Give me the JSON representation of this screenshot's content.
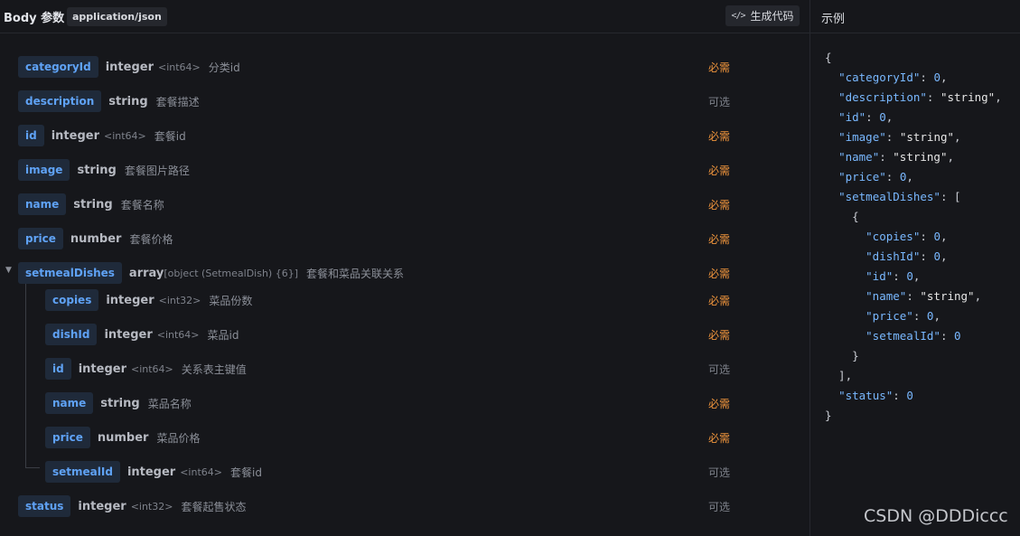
{
  "header": {
    "title": "Body 参数",
    "content_type": "application/json",
    "gen_code_icon": "</>",
    "gen_code_label": "生成代码"
  },
  "params": [
    {
      "name": "categoryId",
      "type": "integer",
      "format": "<int64>",
      "desc": "分类id",
      "req": "必需"
    },
    {
      "name": "description",
      "type": "string",
      "format": "",
      "desc": "套餐描述",
      "req": "可选"
    },
    {
      "name": "id",
      "type": "integer",
      "format": "<int64>",
      "desc": "套餐id",
      "req": "必需"
    },
    {
      "name": "image",
      "type": "string",
      "format": "",
      "desc": "套餐图片路径",
      "req": "必需"
    },
    {
      "name": "name",
      "type": "string",
      "format": "",
      "desc": "套餐名称",
      "req": "必需"
    },
    {
      "name": "price",
      "type": "number",
      "format": "",
      "desc": "套餐价格",
      "req": "必需"
    },
    {
      "name": "setmealDishes",
      "type": "array",
      "format": "[object (SetmealDish) {6}]",
      "desc": "套餐和菜品关联关系",
      "req": "必需",
      "toggle": "▼"
    },
    {
      "name": "copies",
      "type": "integer",
      "format": "<int32>",
      "desc": "菜品份数",
      "req": "必需"
    },
    {
      "name": "dishId",
      "type": "integer",
      "format": "<int64>",
      "desc": "菜品id",
      "req": "必需"
    },
    {
      "name": "id",
      "type": "integer",
      "format": "<int64>",
      "desc": "关系表主键值",
      "req": "可选"
    },
    {
      "name": "name",
      "type": "string",
      "format": "",
      "desc": "菜品名称",
      "req": "必需"
    },
    {
      "name": "price",
      "type": "number",
      "format": "",
      "desc": "菜品价格",
      "req": "必需"
    },
    {
      "name": "setmealId",
      "type": "integer",
      "format": "<int64>",
      "desc": "套餐id",
      "req": "可选"
    },
    {
      "name": "status",
      "type": "integer",
      "format": "<int32>",
      "desc": "套餐起售状态",
      "req": "可选"
    }
  ],
  "example": {
    "title": "示例",
    "lines": [
      [
        {
          "t": "p",
          "v": "{"
        }
      ],
      [
        {
          "t": "p",
          "v": "  "
        },
        {
          "t": "k",
          "v": "\"categoryId\""
        },
        {
          "t": "p",
          "v": ": "
        },
        {
          "t": "n",
          "v": "0"
        },
        {
          "t": "p",
          "v": ","
        }
      ],
      [
        {
          "t": "p",
          "v": "  "
        },
        {
          "t": "k",
          "v": "\"description\""
        },
        {
          "t": "p",
          "v": ": "
        },
        {
          "t": "s",
          "v": "\"string\""
        },
        {
          "t": "p",
          "v": ","
        }
      ],
      [
        {
          "t": "p",
          "v": "  "
        },
        {
          "t": "k",
          "v": "\"id\""
        },
        {
          "t": "p",
          "v": ": "
        },
        {
          "t": "n",
          "v": "0"
        },
        {
          "t": "p",
          "v": ","
        }
      ],
      [
        {
          "t": "p",
          "v": "  "
        },
        {
          "t": "k",
          "v": "\"image\""
        },
        {
          "t": "p",
          "v": ": "
        },
        {
          "t": "s",
          "v": "\"string\""
        },
        {
          "t": "p",
          "v": ","
        }
      ],
      [
        {
          "t": "p",
          "v": "  "
        },
        {
          "t": "k",
          "v": "\"name\""
        },
        {
          "t": "p",
          "v": ": "
        },
        {
          "t": "s",
          "v": "\"string\""
        },
        {
          "t": "p",
          "v": ","
        }
      ],
      [
        {
          "t": "p",
          "v": "  "
        },
        {
          "t": "k",
          "v": "\"price\""
        },
        {
          "t": "p",
          "v": ": "
        },
        {
          "t": "n",
          "v": "0"
        },
        {
          "t": "p",
          "v": ","
        }
      ],
      [
        {
          "t": "p",
          "v": "  "
        },
        {
          "t": "k",
          "v": "\"setmealDishes\""
        },
        {
          "t": "p",
          "v": ": ["
        }
      ],
      [
        {
          "t": "p",
          "v": "    {"
        }
      ],
      [
        {
          "t": "p",
          "v": "      "
        },
        {
          "t": "k",
          "v": "\"copies\""
        },
        {
          "t": "p",
          "v": ": "
        },
        {
          "t": "n",
          "v": "0"
        },
        {
          "t": "p",
          "v": ","
        }
      ],
      [
        {
          "t": "p",
          "v": "      "
        },
        {
          "t": "k",
          "v": "\"dishId\""
        },
        {
          "t": "p",
          "v": ": "
        },
        {
          "t": "n",
          "v": "0"
        },
        {
          "t": "p",
          "v": ","
        }
      ],
      [
        {
          "t": "p",
          "v": "      "
        },
        {
          "t": "k",
          "v": "\"id\""
        },
        {
          "t": "p",
          "v": ": "
        },
        {
          "t": "n",
          "v": "0"
        },
        {
          "t": "p",
          "v": ","
        }
      ],
      [
        {
          "t": "p",
          "v": "      "
        },
        {
          "t": "k",
          "v": "\"name\""
        },
        {
          "t": "p",
          "v": ": "
        },
        {
          "t": "s",
          "v": "\"string\""
        },
        {
          "t": "p",
          "v": ","
        }
      ],
      [
        {
          "t": "p",
          "v": "      "
        },
        {
          "t": "k",
          "v": "\"price\""
        },
        {
          "t": "p",
          "v": ": "
        },
        {
          "t": "n",
          "v": "0"
        },
        {
          "t": "p",
          "v": ","
        }
      ],
      [
        {
          "t": "p",
          "v": "      "
        },
        {
          "t": "k",
          "v": "\"setmealId\""
        },
        {
          "t": "p",
          "v": ": "
        },
        {
          "t": "n",
          "v": "0"
        }
      ],
      [
        {
          "t": "p",
          "v": "    }"
        }
      ],
      [
        {
          "t": "p",
          "v": "  ],"
        }
      ],
      [
        {
          "t": "p",
          "v": "  "
        },
        {
          "t": "k",
          "v": "\"status\""
        },
        {
          "t": "p",
          "v": ": "
        },
        {
          "t": "n",
          "v": "0"
        }
      ],
      [
        {
          "t": "p",
          "v": "}"
        }
      ]
    ]
  },
  "watermark": "CSDN @DDDiccc"
}
